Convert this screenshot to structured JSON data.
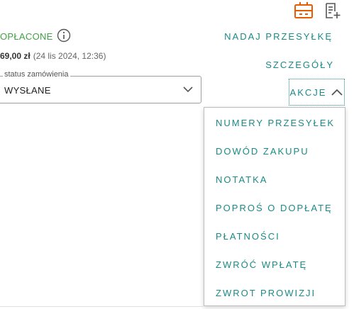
{
  "header_icons": [
    {
      "icon": "label-printer-icon",
      "color": "#e65c00"
    },
    {
      "icon": "add-note-icon",
      "color": "#555555"
    }
  ],
  "payment": {
    "status": "OPŁACONE",
    "status_color": "#43a047",
    "info_icon": "info-icon",
    "amount": "69,00 zł",
    "date": "(24 lis 2024, 12:36)"
  },
  "actions": {
    "ship_label": "NADAJ PRZESYŁKĘ",
    "details_label": "SZCZEGÓŁY",
    "more_label": "AKCJE",
    "accent_color": "#1a8a85"
  },
  "order_status": {
    "legend": "status zamówienia",
    "value": "WYSŁANE"
  },
  "menu": {
    "items": [
      {
        "label": "NUMERY PRZESYŁEK"
      },
      {
        "label": "DOWÓD ZAKUPU"
      },
      {
        "label": "NOTATKA"
      },
      {
        "label": "POPROŚ O DOPŁATĘ"
      },
      {
        "label": "PŁATNOŚCI"
      },
      {
        "label": "ZWRÓĆ WPŁATĘ"
      },
      {
        "label": "ZWROT PROWIZJI"
      }
    ]
  }
}
